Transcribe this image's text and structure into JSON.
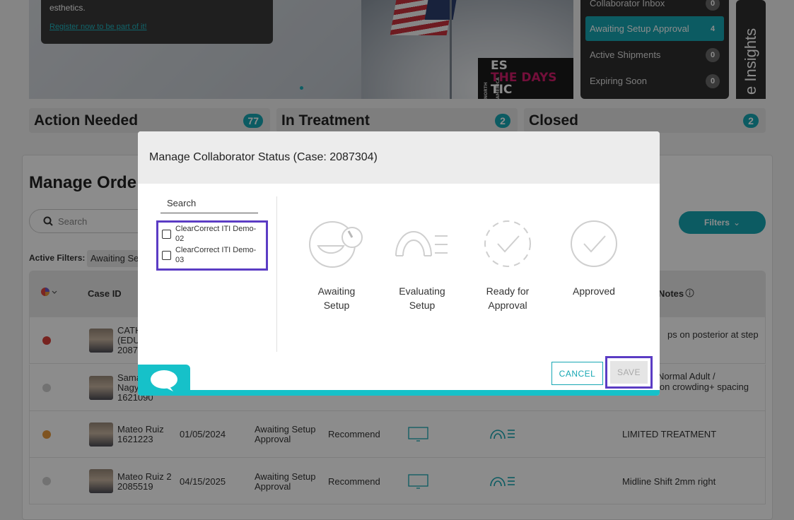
{
  "banner": {
    "promo_text": "esthetics.",
    "promo_link": "Register now to be part of it!",
    "logo_line1": "ES",
    "logo_line2": "THE DAYS",
    "logo_line3": "TIC",
    "logo_vertical": "NORTH AMERICA"
  },
  "collaborator_panel": {
    "items": [
      {
        "label": "Collaborator Inbox",
        "count": "0"
      },
      {
        "label": "Awaiting Setup Approval",
        "count": "4"
      },
      {
        "label": "Active Shipments",
        "count": "0"
      },
      {
        "label": "Expiring Soon",
        "count": "0"
      }
    ],
    "insights_label": "e Insights"
  },
  "status_tabs": [
    {
      "label": "Action Needed",
      "count": "77"
    },
    {
      "label": "In Treatment",
      "count": "2"
    },
    {
      "label": "Closed",
      "count": "2"
    }
  ],
  "orders": {
    "title": "Manage Orde",
    "search_placeholder": "Search",
    "filters_label": "Filters",
    "active_filters_label": "Active Filters:",
    "active_filter_chip": "Awaiting Se",
    "columns": {
      "case_id": "Case ID",
      "notes": "Notes"
    },
    "rows": [
      {
        "name_line1": "CATH",
        "name_line2": "(EDU",
        "name_line3": "2087",
        "date": "",
        "status_line1": "",
        "status_line2": "",
        "recommend": "",
        "notes": "ps on posterior at step",
        "notes2": "",
        "dot_color": "#d9403a"
      },
      {
        "name_line1": "Sama",
        "name_line2": "Nagy",
        "name_line3": "1621090",
        "date": "",
        "status_line1": "",
        "status_line2": "",
        "recommend": "",
        "notes": "Normal Adult /",
        "notes2": "ion crowding+ spacing",
        "dot_color": "#d0d0d0"
      },
      {
        "name_line1": "Mateo Ruiz",
        "name_line2": "1621223",
        "name_line3": "",
        "date": "01/05/2024",
        "status_line1": "Awaiting Setup",
        "status_line2": "Approval",
        "recommend": "Recommend",
        "notes": "LIMITED TREATMENT",
        "notes2": "",
        "dot_color": "#e89a3c"
      },
      {
        "name_line1": "Mateo Ruiz 2",
        "name_line2": "2085519",
        "name_line3": "",
        "date": "04/15/2025",
        "status_line1": "Awaiting Setup",
        "status_line2": "Approval",
        "recommend": "Recommend",
        "notes": "Midline Shift 2mm right",
        "notes2": "",
        "dot_color": "#d0d0d0"
      }
    ]
  },
  "modal": {
    "title": "Manage Collaborator Status (Case: 2087304)",
    "search_label": "Search",
    "collaborators": [
      {
        "line1": "ClearCorrect ITI Demo-",
        "line2": "02"
      },
      {
        "line1": "ClearCorrect ITI Demo-",
        "line2": "03"
      }
    ],
    "steps": [
      {
        "line1": "Awaiting",
        "line2": "Setup"
      },
      {
        "line1": "Evaluating",
        "line2": "Setup"
      },
      {
        "line1": "Ready for",
        "line2": "Approval"
      },
      {
        "line1": "Approved",
        "line2": ""
      }
    ],
    "cancel_label": "CANCEL",
    "save_label": "SAVE"
  },
  "colors": {
    "accent": "#16a7b3",
    "highlight": "#5b3cc4"
  }
}
